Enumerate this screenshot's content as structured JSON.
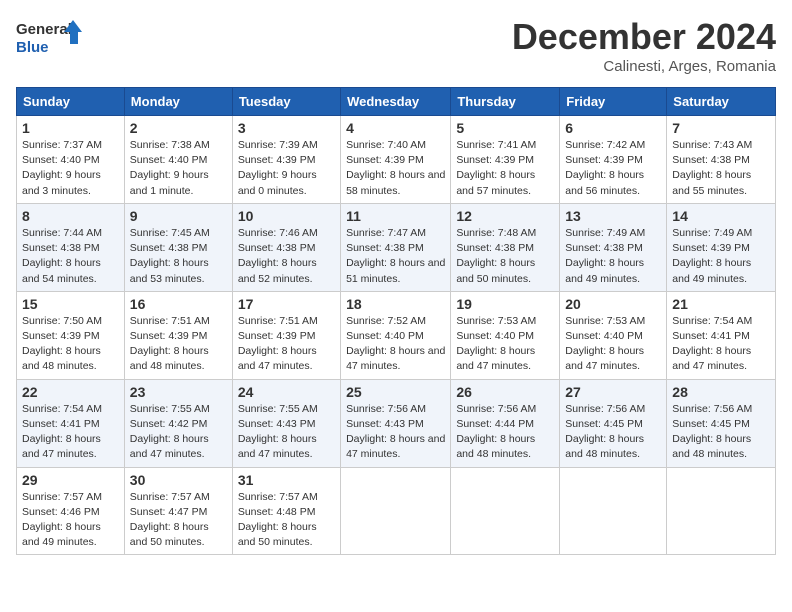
{
  "logo": {
    "line1": "General",
    "line2": "Blue"
  },
  "title": "December 2024",
  "location": "Calinesti, Arges, Romania",
  "weekdays": [
    "Sunday",
    "Monday",
    "Tuesday",
    "Wednesday",
    "Thursday",
    "Friday",
    "Saturday"
  ],
  "weeks": [
    [
      {
        "day": "1",
        "sunrise": "Sunrise: 7:37 AM",
        "sunset": "Sunset: 4:40 PM",
        "daylight": "Daylight: 9 hours and 3 minutes."
      },
      {
        "day": "2",
        "sunrise": "Sunrise: 7:38 AM",
        "sunset": "Sunset: 4:40 PM",
        "daylight": "Daylight: 9 hours and 1 minute."
      },
      {
        "day": "3",
        "sunrise": "Sunrise: 7:39 AM",
        "sunset": "Sunset: 4:39 PM",
        "daylight": "Daylight: 9 hours and 0 minutes."
      },
      {
        "day": "4",
        "sunrise": "Sunrise: 7:40 AM",
        "sunset": "Sunset: 4:39 PM",
        "daylight": "Daylight: 8 hours and 58 minutes."
      },
      {
        "day": "5",
        "sunrise": "Sunrise: 7:41 AM",
        "sunset": "Sunset: 4:39 PM",
        "daylight": "Daylight: 8 hours and 57 minutes."
      },
      {
        "day": "6",
        "sunrise": "Sunrise: 7:42 AM",
        "sunset": "Sunset: 4:39 PM",
        "daylight": "Daylight: 8 hours and 56 minutes."
      },
      {
        "day": "7",
        "sunrise": "Sunrise: 7:43 AM",
        "sunset": "Sunset: 4:38 PM",
        "daylight": "Daylight: 8 hours and 55 minutes."
      }
    ],
    [
      {
        "day": "8",
        "sunrise": "Sunrise: 7:44 AM",
        "sunset": "Sunset: 4:38 PM",
        "daylight": "Daylight: 8 hours and 54 minutes."
      },
      {
        "day": "9",
        "sunrise": "Sunrise: 7:45 AM",
        "sunset": "Sunset: 4:38 PM",
        "daylight": "Daylight: 8 hours and 53 minutes."
      },
      {
        "day": "10",
        "sunrise": "Sunrise: 7:46 AM",
        "sunset": "Sunset: 4:38 PM",
        "daylight": "Daylight: 8 hours and 52 minutes."
      },
      {
        "day": "11",
        "sunrise": "Sunrise: 7:47 AM",
        "sunset": "Sunset: 4:38 PM",
        "daylight": "Daylight: 8 hours and 51 minutes."
      },
      {
        "day": "12",
        "sunrise": "Sunrise: 7:48 AM",
        "sunset": "Sunset: 4:38 PM",
        "daylight": "Daylight: 8 hours and 50 minutes."
      },
      {
        "day": "13",
        "sunrise": "Sunrise: 7:49 AM",
        "sunset": "Sunset: 4:38 PM",
        "daylight": "Daylight: 8 hours and 49 minutes."
      },
      {
        "day": "14",
        "sunrise": "Sunrise: 7:49 AM",
        "sunset": "Sunset: 4:39 PM",
        "daylight": "Daylight: 8 hours and 49 minutes."
      }
    ],
    [
      {
        "day": "15",
        "sunrise": "Sunrise: 7:50 AM",
        "sunset": "Sunset: 4:39 PM",
        "daylight": "Daylight: 8 hours and 48 minutes."
      },
      {
        "day": "16",
        "sunrise": "Sunrise: 7:51 AM",
        "sunset": "Sunset: 4:39 PM",
        "daylight": "Daylight: 8 hours and 48 minutes."
      },
      {
        "day": "17",
        "sunrise": "Sunrise: 7:51 AM",
        "sunset": "Sunset: 4:39 PM",
        "daylight": "Daylight: 8 hours and 47 minutes."
      },
      {
        "day": "18",
        "sunrise": "Sunrise: 7:52 AM",
        "sunset": "Sunset: 4:40 PM",
        "daylight": "Daylight: 8 hours and 47 minutes."
      },
      {
        "day": "19",
        "sunrise": "Sunrise: 7:53 AM",
        "sunset": "Sunset: 4:40 PM",
        "daylight": "Daylight: 8 hours and 47 minutes."
      },
      {
        "day": "20",
        "sunrise": "Sunrise: 7:53 AM",
        "sunset": "Sunset: 4:40 PM",
        "daylight": "Daylight: 8 hours and 47 minutes."
      },
      {
        "day": "21",
        "sunrise": "Sunrise: 7:54 AM",
        "sunset": "Sunset: 4:41 PM",
        "daylight": "Daylight: 8 hours and 47 minutes."
      }
    ],
    [
      {
        "day": "22",
        "sunrise": "Sunrise: 7:54 AM",
        "sunset": "Sunset: 4:41 PM",
        "daylight": "Daylight: 8 hours and 47 minutes."
      },
      {
        "day": "23",
        "sunrise": "Sunrise: 7:55 AM",
        "sunset": "Sunset: 4:42 PM",
        "daylight": "Daylight: 8 hours and 47 minutes."
      },
      {
        "day": "24",
        "sunrise": "Sunrise: 7:55 AM",
        "sunset": "Sunset: 4:43 PM",
        "daylight": "Daylight: 8 hours and 47 minutes."
      },
      {
        "day": "25",
        "sunrise": "Sunrise: 7:56 AM",
        "sunset": "Sunset: 4:43 PM",
        "daylight": "Daylight: 8 hours and 47 minutes."
      },
      {
        "day": "26",
        "sunrise": "Sunrise: 7:56 AM",
        "sunset": "Sunset: 4:44 PM",
        "daylight": "Daylight: 8 hours and 48 minutes."
      },
      {
        "day": "27",
        "sunrise": "Sunrise: 7:56 AM",
        "sunset": "Sunset: 4:45 PM",
        "daylight": "Daylight: 8 hours and 48 minutes."
      },
      {
        "day": "28",
        "sunrise": "Sunrise: 7:56 AM",
        "sunset": "Sunset: 4:45 PM",
        "daylight": "Daylight: 8 hours and 48 minutes."
      }
    ],
    [
      {
        "day": "29",
        "sunrise": "Sunrise: 7:57 AM",
        "sunset": "Sunset: 4:46 PM",
        "daylight": "Daylight: 8 hours and 49 minutes."
      },
      {
        "day": "30",
        "sunrise": "Sunrise: 7:57 AM",
        "sunset": "Sunset: 4:47 PM",
        "daylight": "Daylight: 8 hours and 50 minutes."
      },
      {
        "day": "31",
        "sunrise": "Sunrise: 7:57 AM",
        "sunset": "Sunset: 4:48 PM",
        "daylight": "Daylight: 8 hours and 50 minutes."
      },
      null,
      null,
      null,
      null
    ]
  ]
}
